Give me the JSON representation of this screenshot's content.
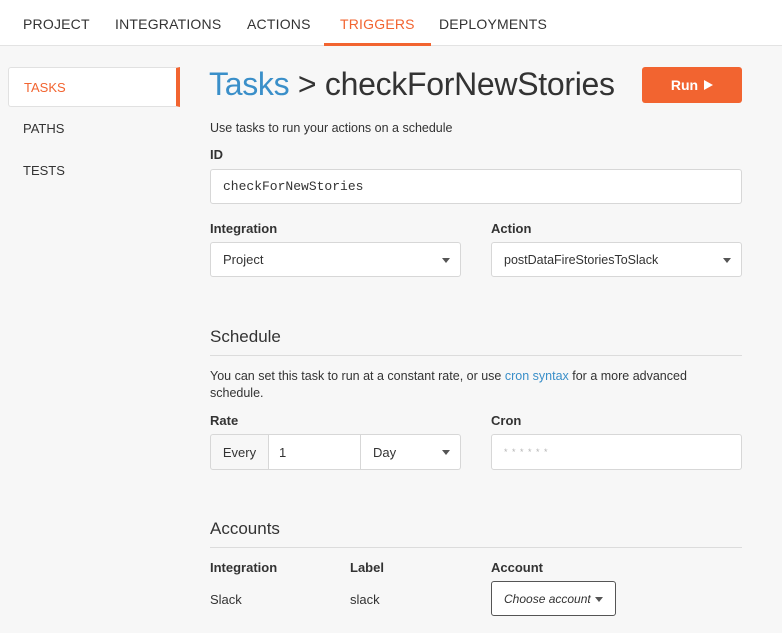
{
  "topnav": {
    "tabs": [
      {
        "label": "PROJECT",
        "active": false
      },
      {
        "label": "INTEGRATIONS",
        "active": false
      },
      {
        "label": "ACTIONS",
        "active": false
      },
      {
        "label": "TRIGGERS",
        "active": true
      },
      {
        "label": "DEPLOYMENTS",
        "active": false
      }
    ]
  },
  "sidebar": {
    "items": [
      {
        "label": "TASKS",
        "active": true
      },
      {
        "label": "PATHS",
        "active": false
      },
      {
        "label": "TESTS",
        "active": false
      }
    ]
  },
  "header": {
    "breadcrumb": "Tasks",
    "separator": ">",
    "task_name": "checkForNewStories",
    "run_label": "Run",
    "run_icon": "play-icon"
  },
  "description": "Use tasks to run your actions on a schedule",
  "form": {
    "id_label": "ID",
    "id_value": "checkForNewStories",
    "integration_label": "Integration",
    "integration_value": "Project",
    "action_label": "Action",
    "action_value": "postDataFireStoriesToSlack"
  },
  "schedule": {
    "title": "Schedule",
    "help_before": "You can set this task to run at a constant rate, or use ",
    "help_link": "cron syntax",
    "help_after": " for a more advanced",
    "help_line2": "schedule.",
    "rate_label": "Rate",
    "every_label": "Every",
    "rate_value": "1",
    "rate_unit": "Day",
    "cron_label": "Cron",
    "cron_placeholder": "* * * * * *"
  },
  "accounts": {
    "title": "Accounts",
    "columns": [
      "Integration",
      "Label",
      "Account"
    ],
    "rows": [
      {
        "integration": "Slack",
        "label": "slack",
        "account_placeholder": "Choose account"
      }
    ]
  },
  "colors": {
    "accent": "#f26430",
    "link": "#3a8fc9"
  }
}
